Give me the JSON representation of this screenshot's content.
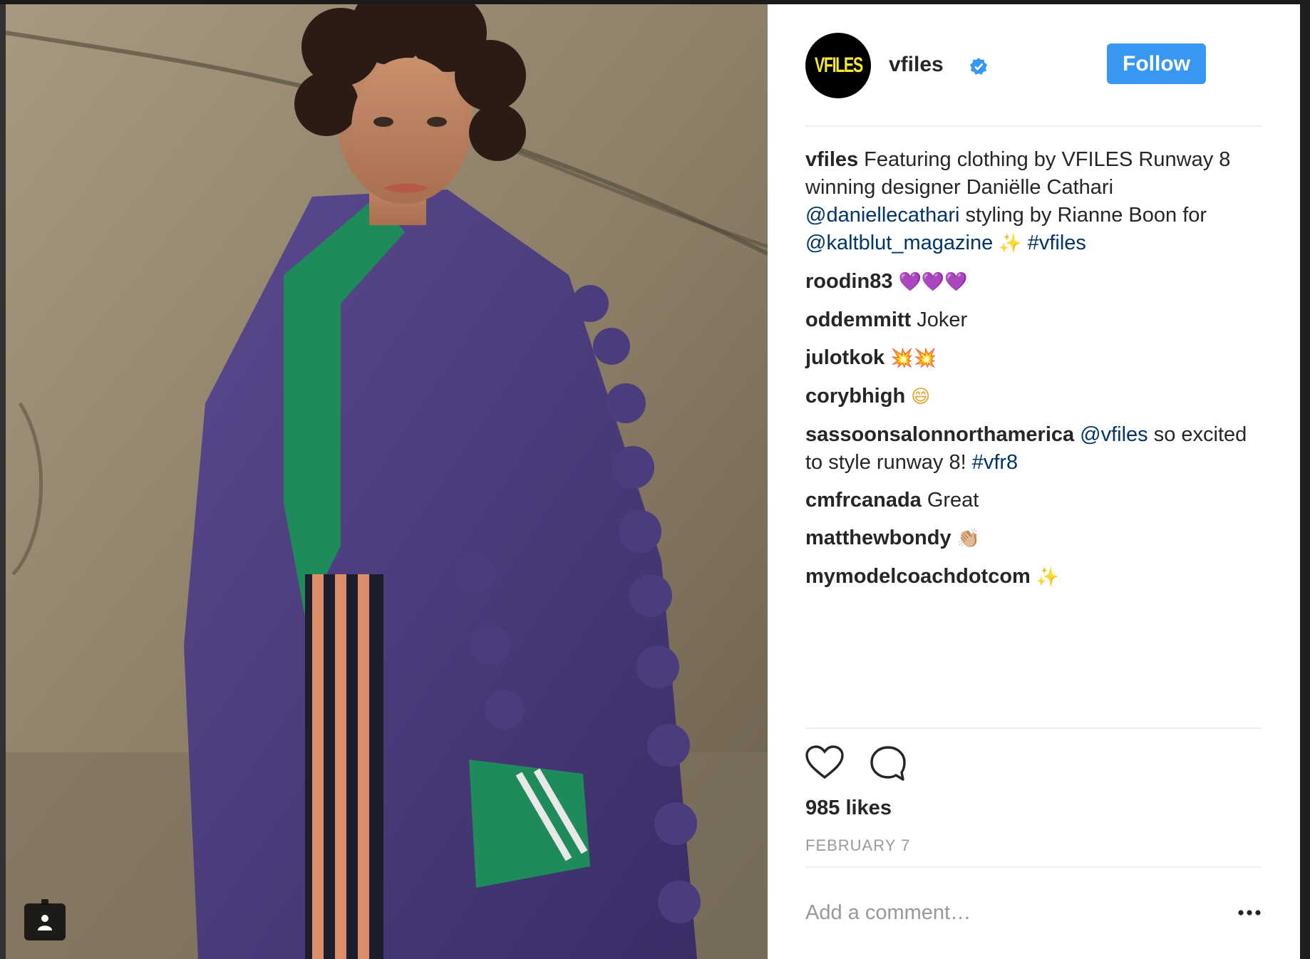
{
  "post": {
    "author": "vfiles",
    "avatar_text": "VFILES",
    "verified_icon": "verified-badge-icon",
    "follow_label": "Follow",
    "caption": {
      "user": "vfiles",
      "text_1": "Featuring clothing by VFILES Runway 8 winning designer Daniëlle Cathari",
      "mention_1": "@daniellecathari",
      "text_2": "styling by Rianne Boon for",
      "mention_2": "@kaltblut_magazine",
      "emoji": "✨",
      "hashtag": "#vfiles"
    },
    "comments": [
      {
        "user": "roodin83",
        "text": "💜💜💜"
      },
      {
        "user": "oddemmitt",
        "text": "Joker"
      },
      {
        "user": "julotkok",
        "text": "💥💥"
      },
      {
        "user": "corybhigh",
        "text": "😄"
      },
      {
        "user": "sassoonsalonnorthamerica",
        "mention": "@vfiles",
        "text": "so excited to style runway 8!",
        "hashtag": "#vfr8"
      },
      {
        "user": "cmfrcanada",
        "text": "Great"
      },
      {
        "user": "matthewbondy",
        "text": "👏🏼"
      },
      {
        "user": "mymodelcoachdotcom",
        "text": "✨"
      }
    ],
    "likes": "985 likes",
    "date": "FEBRUARY 7",
    "add_comment_placeholder": "Add a comment…",
    "more_options": "•••"
  },
  "colors": {
    "follow_button": "#3897f0",
    "mention": "#003569",
    "verified": "#3897f0"
  }
}
